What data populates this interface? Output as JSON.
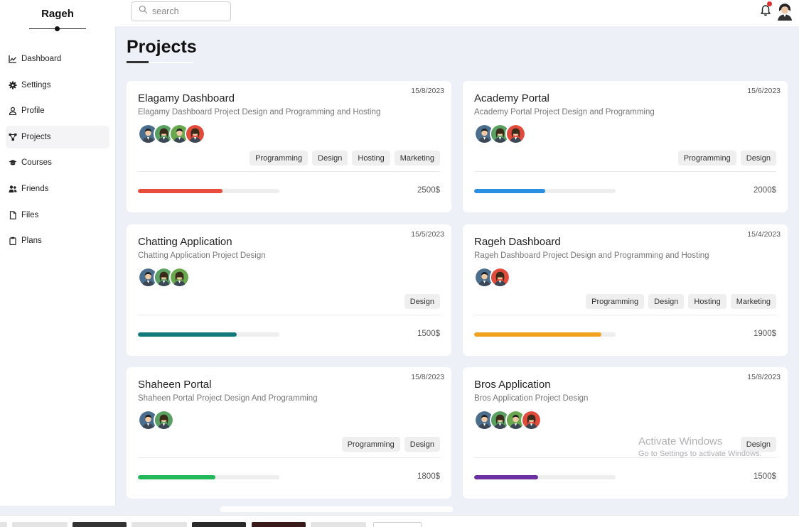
{
  "sidebar": {
    "brand": "Rageh",
    "items": [
      {
        "label": "Dashboard",
        "icon": "chart-line-icon"
      },
      {
        "label": "Settings",
        "icon": "gear-icon"
      },
      {
        "label": "Profile",
        "icon": "user-icon"
      },
      {
        "label": "Projects",
        "icon": "diagram-icon"
      },
      {
        "label": "Courses",
        "icon": "graduation-cap-icon"
      },
      {
        "label": "Friends",
        "icon": "users-icon"
      },
      {
        "label": "Files",
        "icon": "file-icon"
      },
      {
        "label": "Plans",
        "icon": "clipboard-icon"
      }
    ],
    "active": "Projects"
  },
  "topbar": {
    "search_placeholder": "search",
    "notification_icon": "bell-icon",
    "avatar_icon": "user-avatar-icon"
  },
  "main": {
    "title": "Projects"
  },
  "projects": [
    {
      "title": "Elagamy Dashboard",
      "date": "15/8/2023",
      "description": "Elagamy Dashboard Project Design and Programming and Hosting",
      "avatars": [
        "#4a6e8c",
        "#5aa063",
        "#6aa84f",
        "#e14b3b"
      ],
      "tags": [
        "Programming",
        "Design",
        "Hosting",
        "Marketing"
      ],
      "progress": 0.6,
      "progress_color": "#e74c3c",
      "price": "2500$"
    },
    {
      "title": "Academy Portal",
      "date": "15/6/2023",
      "description": "Academy Portal Project Design and Programming",
      "avatars": [
        "#4a6e8c",
        "#5aa063",
        "#e14b3b"
      ],
      "tags": [
        "Programming",
        "Design"
      ],
      "progress": 0.5,
      "progress_color": "#2a8fe0",
      "price": "2000$"
    },
    {
      "title": "Chatting Application",
      "date": "15/5/2023",
      "description": "Chatting Application Project Design",
      "avatars": [
        "#4a6e8c",
        "#5aa063",
        "#6aa84f"
      ],
      "tags": [
        "Design"
      ],
      "progress": 0.7,
      "progress_color": "#127a7a",
      "price": "1500$"
    },
    {
      "title": "Rageh Dashboard",
      "date": "15/4/2023",
      "description": "Rageh Dashboard Project Design and Programming and Hosting",
      "avatars": [
        "#4a6e8c",
        "#e14b3b"
      ],
      "tags": [
        "Programming",
        "Design",
        "Hosting",
        "Marketing"
      ],
      "progress": 0.9,
      "progress_color": "#f0a21e",
      "price": "1900$"
    },
    {
      "title": "Shaheen Portal",
      "date": "15/8/2023",
      "description": "Shaheen Portal Project Design And Programming",
      "avatars": [
        "#4a6e8c",
        "#5aa063"
      ],
      "tags": [
        "Programming",
        "Design"
      ],
      "progress": 0.55,
      "progress_color": "#22b85a",
      "price": "1800$"
    },
    {
      "title": "Bros Application",
      "date": "15/8/2023",
      "description": "Bros Application Project Design",
      "avatars": [
        "#4a6e8c",
        "#5aa063",
        "#6aa84f",
        "#e14b3b"
      ],
      "tags": [
        "Design"
      ],
      "progress": 0.45,
      "progress_color": "#6c2fa0",
      "price": "1500$"
    }
  ],
  "watermark": {
    "line1": "Activate Windows",
    "line2": "Go to Settings to activate Windows."
  }
}
